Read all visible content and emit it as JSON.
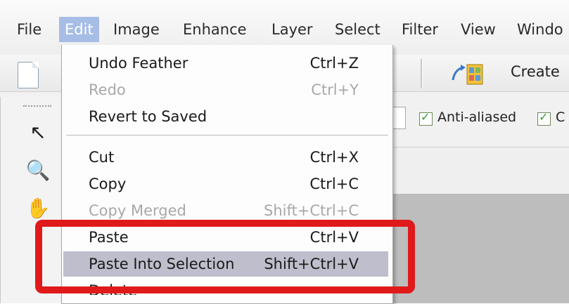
{
  "menubar": {
    "items": [
      "File",
      "Edit",
      "Image",
      "Enhance",
      "Layer",
      "Select",
      "Filter",
      "View",
      "Windo"
    ],
    "active": "Edit"
  },
  "toolbar": {
    "create_label": "Create"
  },
  "options": {
    "anti_aliased_label": "Anti-aliased",
    "second_checkbox_label": "C"
  },
  "edit_menu": {
    "items": [
      {
        "label": "Undo Feather",
        "shortcut": "Ctrl+Z",
        "enabled": true
      },
      {
        "label": "Redo",
        "shortcut": "Ctrl+Y",
        "enabled": false
      },
      {
        "label": "Revert to Saved",
        "shortcut": "",
        "enabled": true
      },
      {
        "label": "Cut",
        "shortcut": "Ctrl+X",
        "enabled": true
      },
      {
        "label": "Copy",
        "shortcut": "Ctrl+C",
        "enabled": true
      },
      {
        "label": "Copy Merged",
        "shortcut": "Shift+Ctrl+C",
        "enabled": false
      },
      {
        "label": "Paste",
        "shortcut": "Ctrl+V",
        "enabled": true
      },
      {
        "label": "Paste Into Selection",
        "shortcut": "Shift+Ctrl+V",
        "enabled": true,
        "highlighted": true
      },
      {
        "label": "Delete",
        "shortcut": "",
        "enabled": true
      }
    ]
  },
  "annotation": {
    "color": "#e01a1a"
  },
  "icons": {
    "new": "new-document-icon",
    "create": "create-photo-icon",
    "move": "move-tool-icon",
    "zoom": "zoom-tool-icon",
    "hand": "hand-tool-icon"
  }
}
